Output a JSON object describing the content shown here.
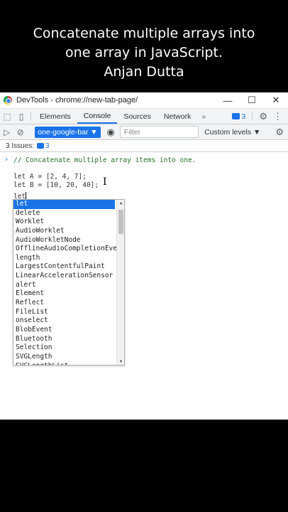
{
  "caption": {
    "line1": "Concatenate multiple arrays into",
    "line2": "one array in JavaScript.",
    "line3": "Anjan Dutta"
  },
  "window": {
    "title": "DevTools - chrome://new-tab-page/",
    "minimize": "—",
    "maximize": "☐",
    "close": "✕"
  },
  "tabs": {
    "items": [
      "Elements",
      "Console",
      "Sources",
      "Network"
    ],
    "active": "Console",
    "more": "»",
    "issues_count": "3"
  },
  "toolbar": {
    "context": "one-google-bar ▼",
    "filter_placeholder": "Filter",
    "levels": "Custom levels ▼"
  },
  "issues_bar": {
    "label": "3 Issues:",
    "count": "3"
  },
  "console": {
    "prompt": "›",
    "comment": "// Concatenate multiple array items into one.",
    "line_a": "let A = [2, 4, 7];",
    "line_b": "let B = [10, 20, 40];",
    "typed": "let"
  },
  "autocomplete": {
    "items": [
      "let",
      "delete",
      "Worklet",
      "AudioWorklet",
      "AudioWorkletNode",
      "OfflineAudioCompletionEvent",
      "length",
      "LargestContentfulPaint",
      "LinearAccelerationSensor",
      "alert",
      "Element",
      "Reflect",
      "FileList",
      "onselect",
      "BlobEvent",
      "Bluetooth",
      "Selection",
      "SVGLength",
      "SVGLengthList"
    ],
    "selected_index": 0
  },
  "colors": {
    "accent": "#1a73e8",
    "comment": "#236e25",
    "background": "#000000"
  }
}
